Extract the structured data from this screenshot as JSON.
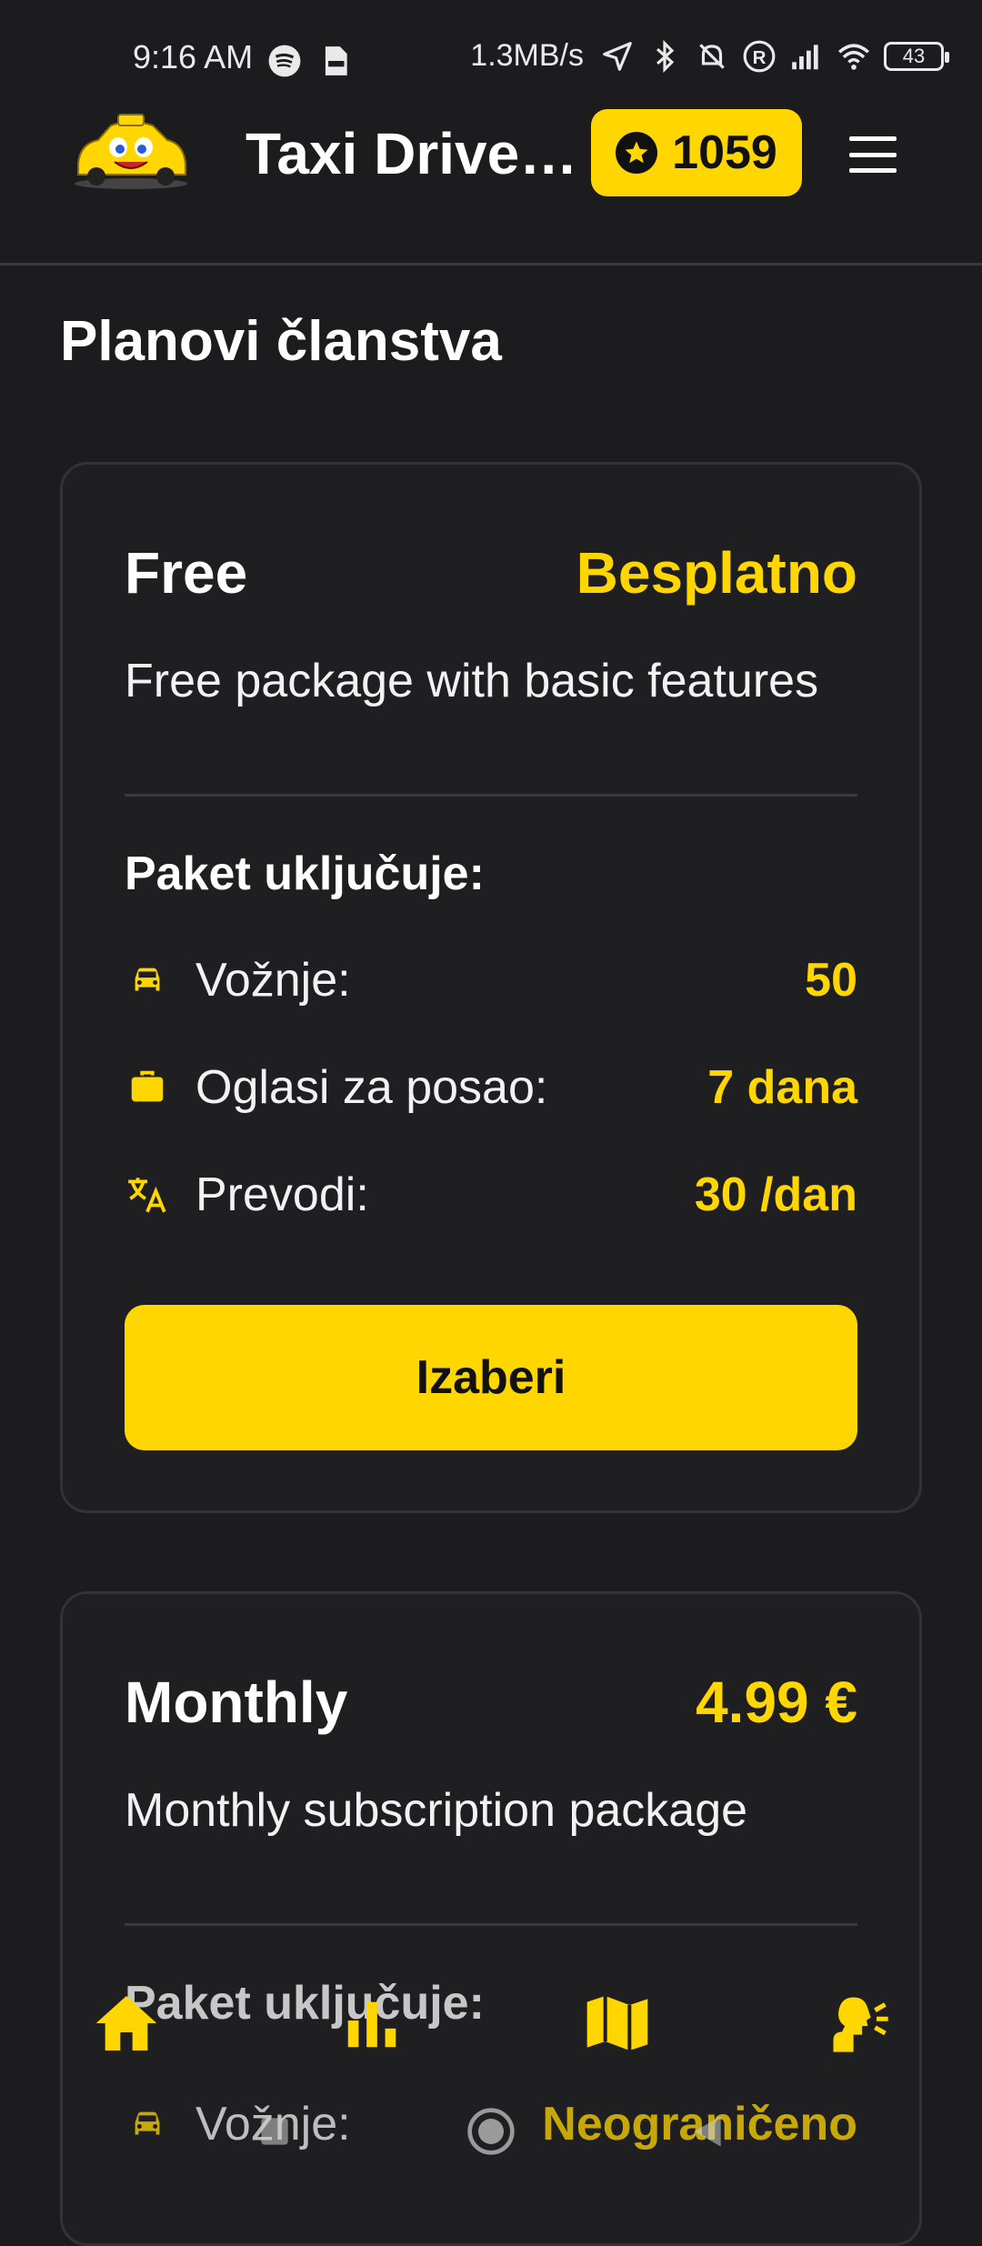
{
  "status_bar": {
    "time": "9:16 AM",
    "speed": "1.3MB/s",
    "battery": "43"
  },
  "header": {
    "app_title": "Taxi Driver...",
    "points": "1059",
    "icons": [
      "taxi-logo",
      "star-icon",
      "menu-icon"
    ]
  },
  "page": {
    "title": "Planovi članstva"
  },
  "plans": [
    {
      "name": "Free",
      "price": "Besplatno",
      "description": "Free package with basic features",
      "includes_label": "Paket uključuje:",
      "features": [
        {
          "icon": "car-icon",
          "label": "Vožnje:",
          "value": "50"
        },
        {
          "icon": "briefcase-icon",
          "label": "Oglasi za posao:",
          "value": "7 dana"
        },
        {
          "icon": "translate-icon",
          "label": "Prevodi:",
          "value": "30 /dan"
        }
      ],
      "button_label": "Izaberi"
    },
    {
      "name": "Monthly",
      "price": "4.99 €",
      "description": "Monthly subscription package",
      "includes_label": "Paket uključuje:",
      "features": [
        {
          "icon": "car-icon",
          "label": "Vožnje:",
          "value": "Neograničeno"
        }
      ]
    }
  ],
  "bottom_nav": {
    "items": [
      "home-icon",
      "stats-icon",
      "map-icon",
      "voice-icon"
    ]
  },
  "colors": {
    "accent": "#ffd600",
    "background": "#1c1c1e",
    "card": "#1f1f21"
  }
}
